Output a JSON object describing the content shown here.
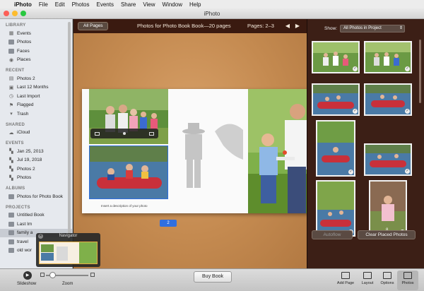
{
  "menubar": {
    "apple": "",
    "app": "iPhoto",
    "items": [
      "File",
      "Edit",
      "Photos",
      "Events",
      "Share",
      "View",
      "Window",
      "Help"
    ]
  },
  "window": {
    "title": "iPhoto"
  },
  "sidebar": {
    "sections": [
      {
        "title": "LIBRARY",
        "items": [
          {
            "label": "Events",
            "icon": "events-icon"
          },
          {
            "label": "Photos",
            "icon": "photos-icon"
          },
          {
            "label": "Faces",
            "icon": "faces-icon"
          },
          {
            "label": "Places",
            "icon": "places-icon"
          }
        ]
      },
      {
        "title": "RECENT",
        "items": [
          {
            "label": "Photos 2",
            "icon": "album-icon"
          },
          {
            "label": "Last 12 Months",
            "icon": "calendar-icon"
          },
          {
            "label": "Last Import",
            "icon": "clock-icon"
          },
          {
            "label": "Flagged",
            "icon": "flag-icon"
          },
          {
            "label": "Trash",
            "icon": "trash-icon"
          }
        ]
      },
      {
        "title": "SHARED",
        "items": [
          {
            "label": "iCloud",
            "icon": "cloud-icon"
          }
        ]
      },
      {
        "title": "EVENTS",
        "items": [
          {
            "label": "Jan 25, 2013",
            "icon": "event-icon"
          },
          {
            "label": "Jul 19, 2018",
            "icon": "event-icon"
          },
          {
            "label": "Photos 2",
            "icon": "event-icon"
          },
          {
            "label": "Photos",
            "icon": "event-icon"
          }
        ]
      },
      {
        "title": "ALBUMS",
        "items": [
          {
            "label": "Photos for Photo Book",
            "icon": "album-icon"
          }
        ]
      },
      {
        "title": "PROJECTS",
        "items": [
          {
            "label": "Untitled Book",
            "icon": "book-icon"
          },
          {
            "label": "Last Im",
            "icon": "book-icon"
          },
          {
            "label": "family a",
            "icon": "book-icon"
          },
          {
            "label": "travel",
            "icon": "book-icon"
          },
          {
            "label": "old wor",
            "icon": "book-icon"
          }
        ]
      }
    ]
  },
  "navigator": {
    "title": "Navigator",
    "close": "✕"
  },
  "header": {
    "all_pages": "All Pages",
    "title": "Photos for Photo Book Book—20 pages",
    "pages": "Pages: 2–3",
    "prev": "◀",
    "next": "▶"
  },
  "book": {
    "caption": "Insert a description of your photo",
    "page_number": "2"
  },
  "rightpanel": {
    "show_label": "Show:",
    "show_value": "All Photos in Project",
    "count_label": "8",
    "autoflow": "Autoflow",
    "clear": "Clear Placed Photos"
  },
  "bottombar": {
    "slideshow": "Slideshow",
    "zoom": "Zoom",
    "buy_book": "Buy Book",
    "tools": [
      "Add Page",
      "Layout",
      "Options",
      "Photos"
    ]
  },
  "colors": {
    "accent": "#2f6fe0",
    "panel_bg": "#3c1f16",
    "canvas": "#c48a50"
  }
}
